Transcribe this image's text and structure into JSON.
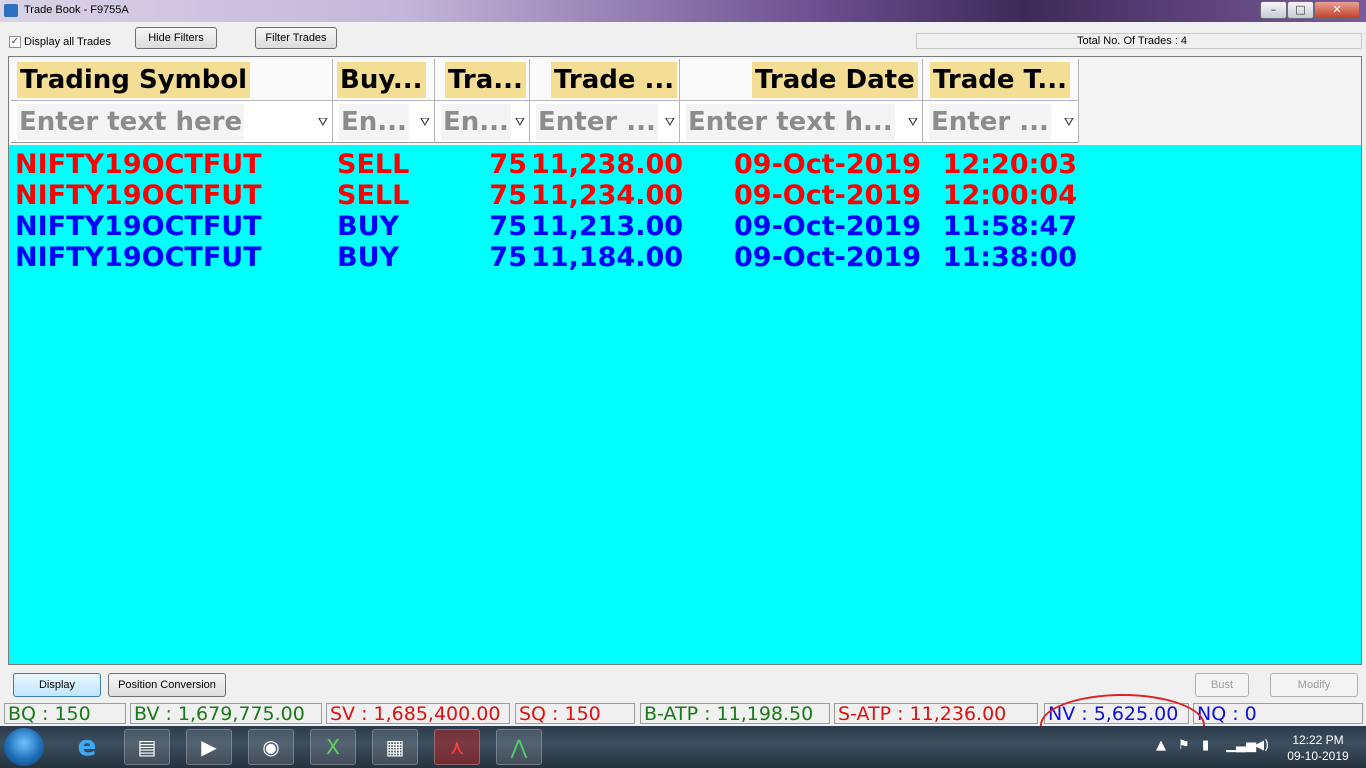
{
  "window": {
    "title": "Trade Book - F9755A",
    "minimize_glyph": "–",
    "maximize_glyph": "□",
    "close_glyph": "✕"
  },
  "toolbar": {
    "display_all_label": "Display all Trades",
    "display_all_checked": true,
    "hide_filters_label": "Hide Filters",
    "filter_trades_label": "Filter Trades",
    "total_trades_label": "Total No. Of Trades : 4"
  },
  "grid": {
    "background_color": "#00ffff",
    "columns": [
      {
        "header": "Trading Symbol",
        "filter_placeholder": "Enter text here"
      },
      {
        "header": "Buy...",
        "filter_placeholder": "En..."
      },
      {
        "header": "Tra...",
        "filter_placeholder": "En..."
      },
      {
        "header": "Trade ...",
        "filter_placeholder": "Enter ..."
      },
      {
        "header": "Trade Date",
        "filter_placeholder": "Enter text h..."
      },
      {
        "header": "Trade T...",
        "filter_placeholder": "Enter ..."
      }
    ],
    "rows": [
      {
        "symbol": "NIFTY19OCTFUT",
        "side": "SELL",
        "qty": "75",
        "price": "11,238.00",
        "date": "09-Oct-2019",
        "time": "12:20:03",
        "color": "#ff0000"
      },
      {
        "symbol": "NIFTY19OCTFUT",
        "side": "SELL",
        "qty": "75",
        "price": "11,234.00",
        "date": "09-Oct-2019",
        "time": "12:00:04",
        "color": "#ff0000"
      },
      {
        "symbol": "NIFTY19OCTFUT",
        "side": "BUY",
        "qty": "75",
        "price": "11,213.00",
        "date": "09-Oct-2019",
        "time": "11:58:47",
        "color": "#0000ff"
      },
      {
        "symbol": "NIFTY19OCTFUT",
        "side": "BUY",
        "qty": "75",
        "price": "11,184.00",
        "date": "09-Oct-2019",
        "time": "11:38:00",
        "color": "#0000ff"
      }
    ]
  },
  "actions": {
    "display_label": "Display",
    "position_conversion_label": "Position Conversion",
    "bust_label": "Bust",
    "modify_label": "Modify"
  },
  "status": {
    "bq": "BQ : 150",
    "bv": "BV : 1,679,775.00",
    "sv": "SV : 1,685,400.00",
    "sq": "SQ : 150",
    "batp": "B-ATP : 11,198.50",
    "satp": "S-ATP : 11,236.00",
    "nv": "NV : 5,625.00",
    "nq": "NQ : 0",
    "buy_color": "#1a7a1a",
    "sell_color": "#e01010",
    "net_color": "#1010e0"
  },
  "taskbar": {
    "icons": [
      "internet-explorer-icon",
      "file-explorer-icon",
      "media-player-icon",
      "chrome-icon",
      "excel-icon",
      "calculator-icon",
      "acrobat-icon",
      "trading-terminal-icon"
    ],
    "clock_time": "12:22 PM",
    "clock_date": "09-10-2019"
  }
}
